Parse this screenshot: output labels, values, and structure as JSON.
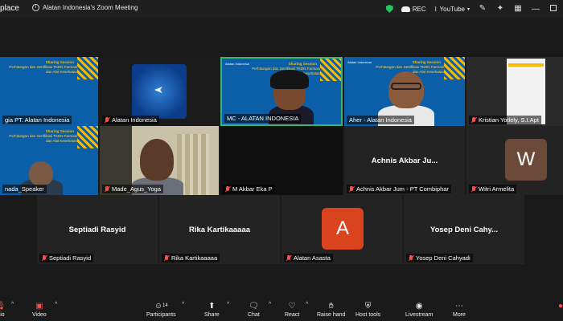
{
  "titlebar": {
    "brand_fragment": "place",
    "title": "Alatan Indonesia's Zoom Meeting",
    "rec": "REC",
    "youtube": "YouTube"
  },
  "tiles": [
    {
      "name": "gia PT. Alatan Indonesia",
      "muted": false
    },
    {
      "name": "Alatan Indonesia",
      "muted": true
    },
    {
      "name": "MC - ALATAN INDONESIA",
      "muted": false
    },
    {
      "name": "Aher - Alatan Indonesia",
      "muted": false
    },
    {
      "name": "Kristian Yotlely, S.I.Apt",
      "muted": true
    },
    {
      "name": "nada_Speaker",
      "muted": false
    },
    {
      "name": "Made_Agus_Yoga",
      "muted": true
    },
    {
      "name": "M Akbar Eka P",
      "muted": true
    },
    {
      "name": "Achnis Akbar Jum - PT Combiphar",
      "display": "Achnis Akbar Ju...",
      "muted": true
    },
    {
      "name": "Witri Armelita",
      "avatar": "W",
      "muted": true
    },
    {
      "name": "Septiadi Rasyid",
      "display": "Septiadi Rasyid",
      "muted": true
    },
    {
      "name": "Rika Kartikaaaaa",
      "display": "Rika Kartikaaaaa",
      "muted": true
    },
    {
      "name": "Alatan Asasta",
      "avatar": "A",
      "muted": true
    },
    {
      "name": "Yosep Deni Cahyadi",
      "display": "Yosep Deni Cahy...",
      "muted": true
    }
  ],
  "slide": {
    "session": "Sharing Session",
    "subtitle": "Perhitungan dan Sertifikasi TKDN Farmasi dan Alat Kesehatan",
    "logo": "Alatan Indonesia"
  },
  "toolbar": {
    "audio": "dio",
    "video": "Video",
    "participants": "Participants",
    "participants_count": "14",
    "share": "Share",
    "chat": "Chat",
    "react": "React",
    "raise_hand": "Raise hand",
    "host_tools": "Host tools",
    "livestream": "Livestream",
    "more": "More"
  },
  "colors": {
    "accent_green": "#22c55e",
    "active_speaker_border": "#3cb371",
    "muted_red": "#ff4d4d",
    "slide_blue": "#0b5fa8",
    "slide_gold": "#f6b800",
    "avatar_w": "#6b4a3a",
    "avatar_a": "#d9431e"
  }
}
